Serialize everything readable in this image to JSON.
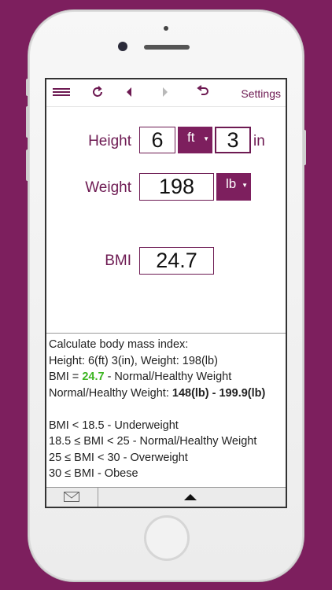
{
  "toolbar": {
    "icons": [
      "menu-icon",
      "refresh-icon",
      "back-icon",
      "forward-icon",
      "undo-icon"
    ],
    "settings_label": "Settings"
  },
  "form": {
    "height_label": "Height",
    "height_ft": "6",
    "height_unit": "ft",
    "height_in": "3",
    "height_in_unit": "in",
    "weight_label": "Weight",
    "weight_value": "198",
    "weight_unit": "lb",
    "bmi_label": "BMI",
    "bmi_value": "24.7"
  },
  "info": {
    "title": "Calculate body mass index:",
    "summary": "Height: 6(ft) 3(in), Weight: 198(lb)",
    "bmi_prefix": "BMI = ",
    "bmi_value": "24.7",
    "bmi_suffix": " - Normal/Healthy Weight",
    "range_prefix": "Normal/Healthy Weight: ",
    "range_value": "148(lb) - 199.9(lb)",
    "categories": [
      "BMI < 18.5 - Underweight",
      "18.5 ≤ BMI < 25 - Normal/Healthy Weight",
      "25 ≤ BMI < 30 - Overweight",
      "30 ≤ BMI - Obese"
    ]
  },
  "bottombar": {
    "icons": [
      "mail-icon",
      "expand-up-icon"
    ]
  },
  "colors": {
    "brand": "#7d1f5e",
    "highlight": "#3cb521"
  }
}
